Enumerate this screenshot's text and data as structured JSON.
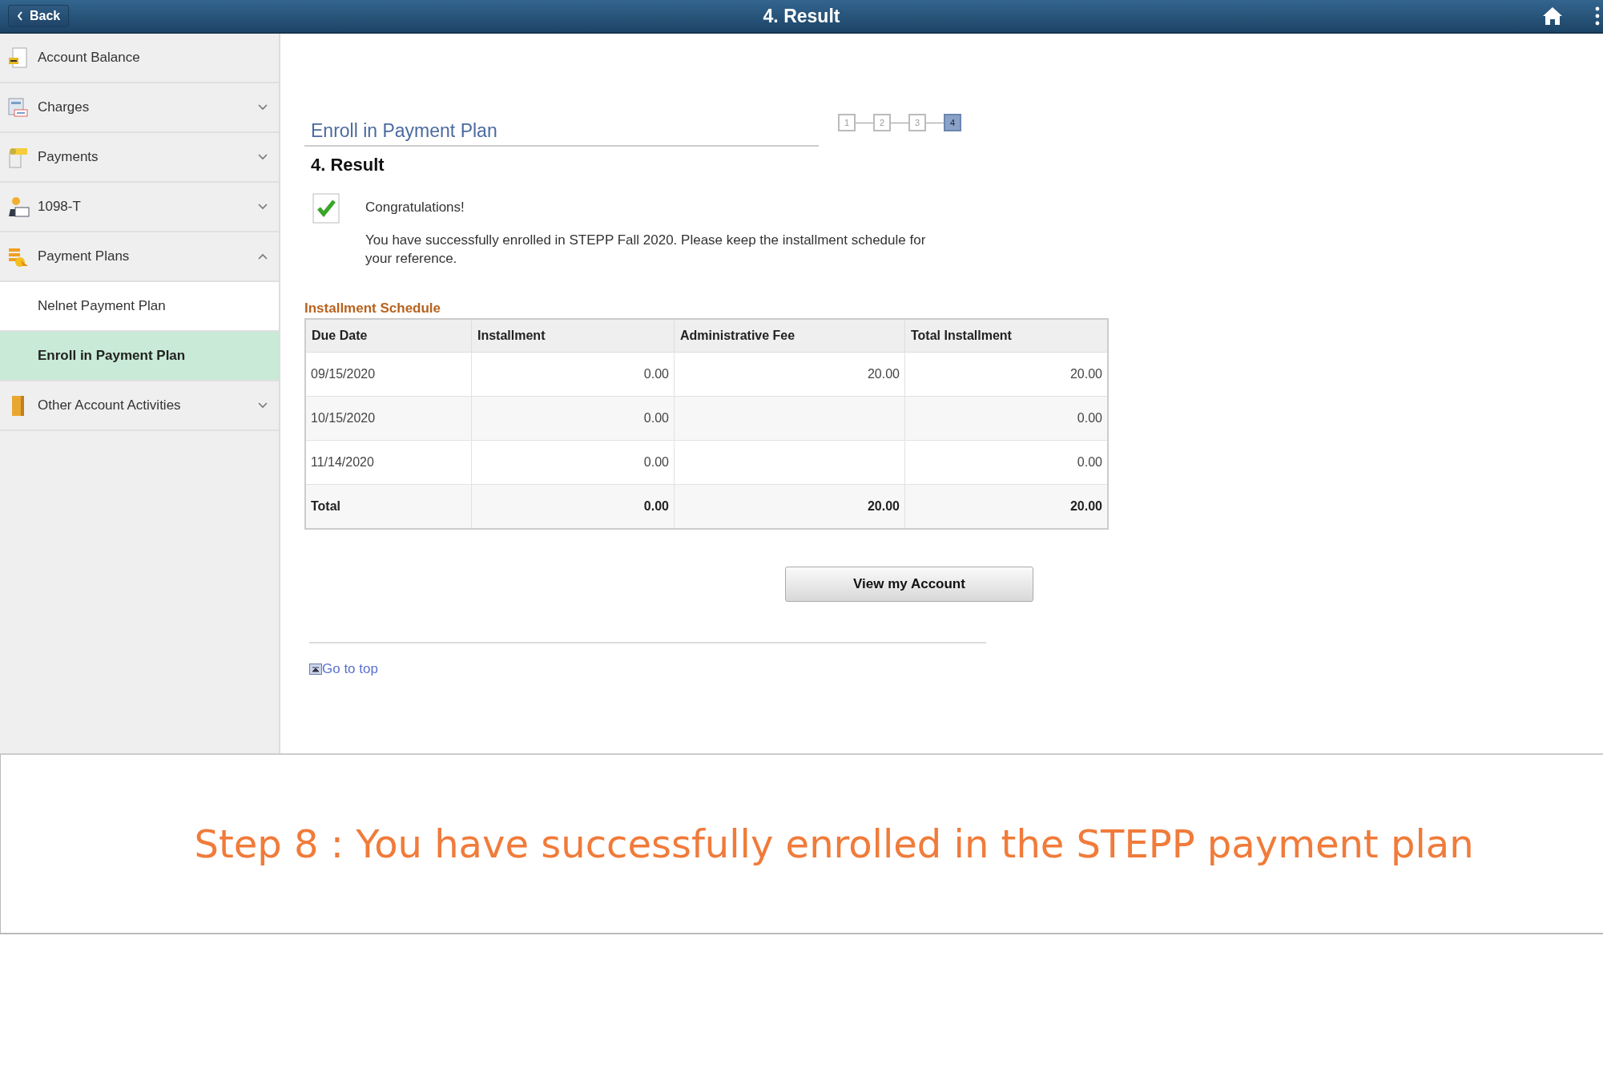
{
  "header": {
    "back": "Back",
    "title": "4. Result"
  },
  "sidebar": {
    "items": [
      {
        "label": "Account Balance"
      },
      {
        "label": "Charges",
        "expanded": false
      },
      {
        "label": "Payments",
        "expanded": false
      },
      {
        "label": "1098-T",
        "expanded": false
      },
      {
        "label": "Payment Plans",
        "expanded": true,
        "children": [
          {
            "label": "Nelnet Payment Plan",
            "selected": false
          },
          {
            "label": "Enroll in Payment Plan",
            "selected": true
          }
        ]
      },
      {
        "label": "Other Account Activities",
        "expanded": false
      }
    ]
  },
  "page": {
    "title": "Enroll in Payment Plan",
    "steps": [
      {
        "label": "1",
        "selected": false
      },
      {
        "label": "2",
        "selected": false
      },
      {
        "label": "3",
        "selected": false
      },
      {
        "label": "4",
        "selected": true
      }
    ],
    "heading": "4. Result",
    "message": {
      "title": "Congratulations!",
      "body": "You have successfully enrolled in STEPP Fall 2020.  Please keep the installment schedule for your reference."
    },
    "table": {
      "caption": "Installment Schedule",
      "columns": [
        "Due Date",
        "Installment",
        "Administrative Fee",
        "Total Installment"
      ],
      "rows": [
        [
          "09/15/2020",
          "0.00",
          "20.00",
          "20.00"
        ],
        [
          "10/15/2020",
          "0.00",
          "",
          "0.00"
        ],
        [
          "11/14/2020",
          "0.00",
          "",
          "0.00"
        ]
      ],
      "total": [
        "Total",
        "0.00",
        "20.00",
        "20.00"
      ]
    },
    "button": "View my Account",
    "go_to_top": "Go to top"
  },
  "caption": "Step 8 : You have successfully enrolled in the STEPP payment plan"
}
